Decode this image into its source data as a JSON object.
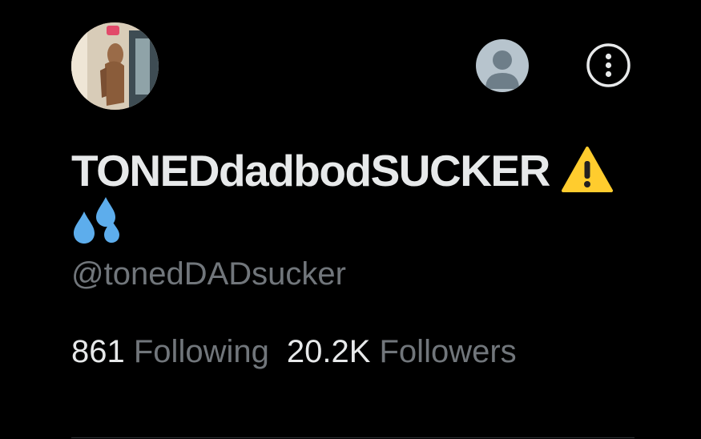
{
  "profile": {
    "display_name": "TONEDdadbodSUCKER",
    "handle": "@tonedDADsucker",
    "name_emojis": [
      "warning-icon",
      "sweat-droplets-icon"
    ]
  },
  "stats": {
    "following_count": "861",
    "following_label": "Following",
    "followers_count": "20.2K",
    "followers_label": "Followers"
  },
  "header": {
    "account_switcher_icon": "default-avatar-icon",
    "more_icon": "more-options-icon"
  },
  "colors": {
    "background": "#000000",
    "primary_text": "#e7e9ea",
    "secondary_text": "#71767b",
    "warning_yellow": "#ffcc2e",
    "droplet_blue": "#5dadec"
  }
}
